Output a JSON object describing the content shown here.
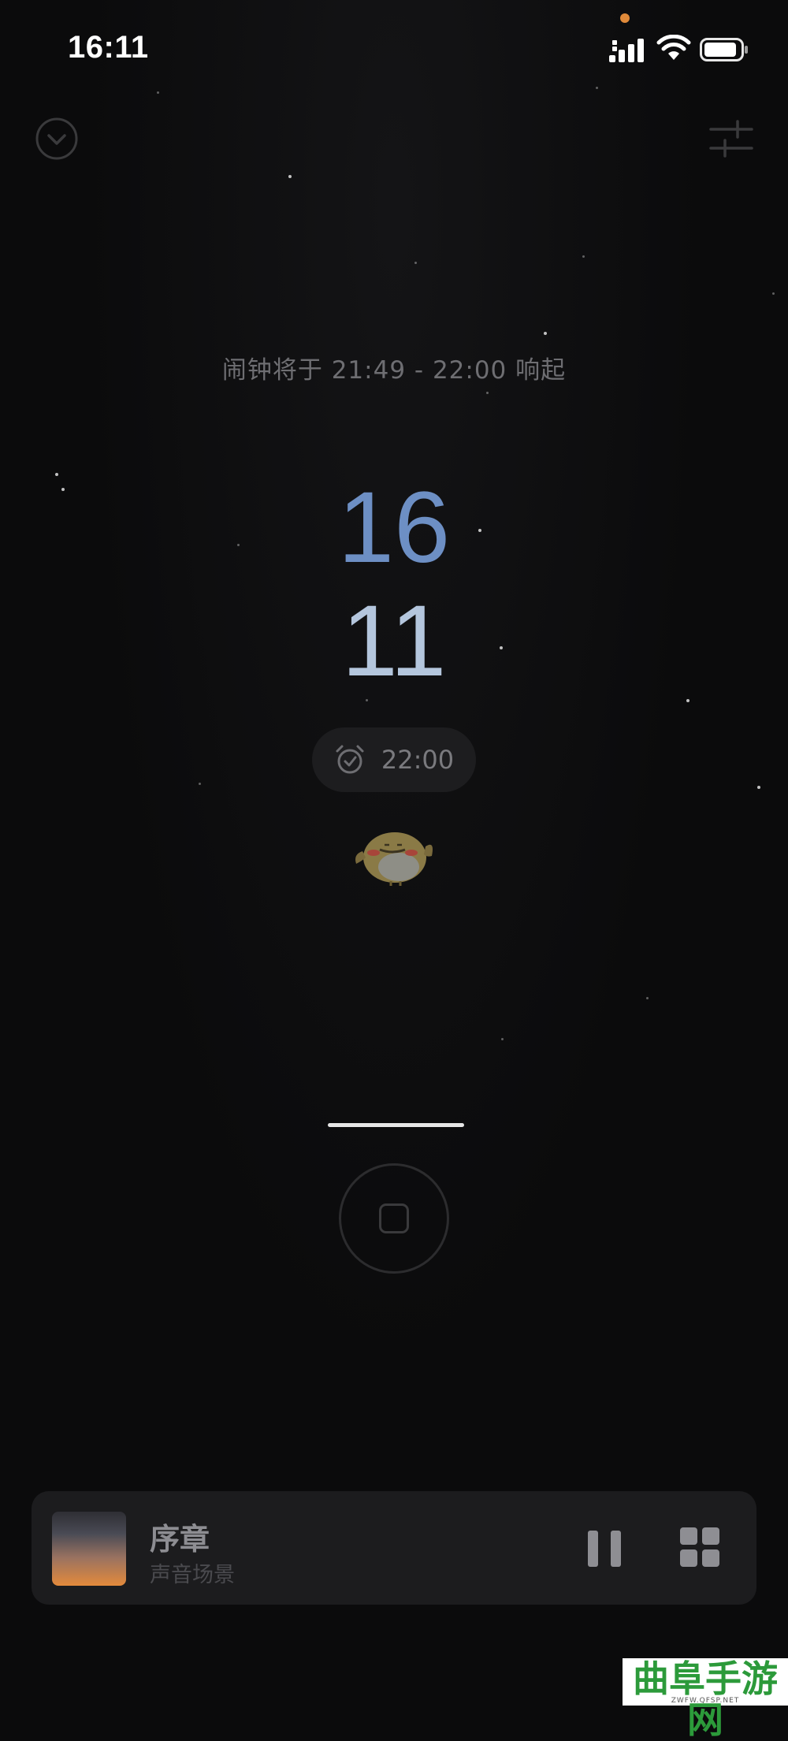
{
  "status_bar": {
    "time": "16:11"
  },
  "header": {
    "collapse_icon": "chevron-down-circle-icon",
    "settings_icon": "sliders-icon"
  },
  "alarm_window_text": "闹钟将于 21:49 - 22:00 响起",
  "clock": {
    "hours": "16",
    "minutes": "11"
  },
  "alarm_pill": {
    "icon": "alarm-clock-icon",
    "time": "22:00"
  },
  "colors": {
    "hours": "#6d8fc4",
    "minutes": "#b4c6dd",
    "status_dot": "#e08a3a"
  },
  "player": {
    "title": "序章",
    "subtitle": "声音场景",
    "pause_icon": "pause-icon",
    "grid_icon": "grid-icon"
  },
  "watermark": {
    "text": "曲阜手游网",
    "sub": "ZWFW.QFSP.NET"
  }
}
